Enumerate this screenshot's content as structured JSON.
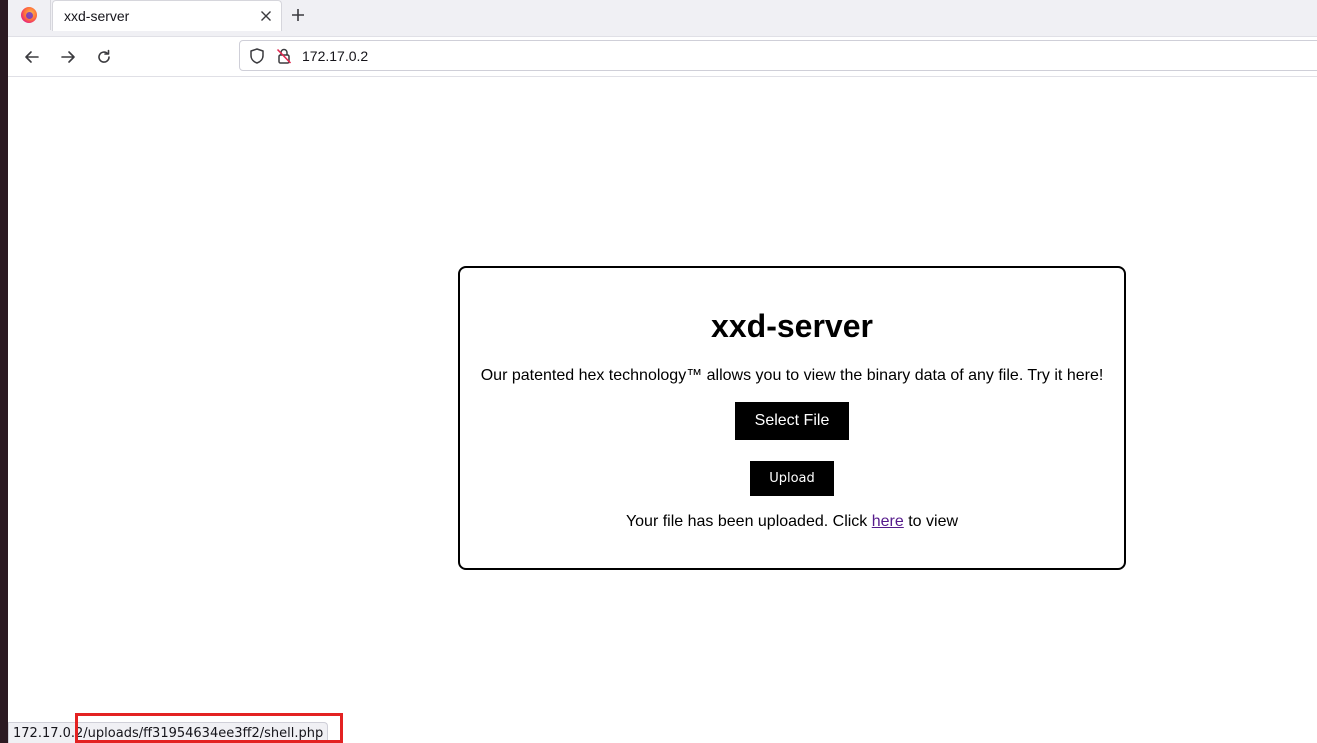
{
  "browser": {
    "tab": {
      "title": "xxd-server"
    },
    "url": "172.17.0.2",
    "icons": {
      "app": "firefox-icon",
      "close": "close-icon",
      "new_tab": "plus-icon",
      "back": "arrow-left-icon",
      "forward": "arrow-right-icon",
      "reload": "reload-icon",
      "tracking": "shield-icon",
      "insecure": "insecure-lock-icon"
    }
  },
  "page": {
    "title": "xxd-server",
    "description": "Our patented hex technology™ allows you to view the binary data of any file. Try it here!",
    "select_button": "Select File",
    "upload_button": "Upload",
    "status_prefix": "Your file has been uploaded. Click ",
    "status_link": "here",
    "status_suffix": " to view"
  },
  "statusbar": {
    "link_url": "172.17.0.2/uploads/ff31954634ee3ff2/shell.php"
  },
  "colors": {
    "highlight": "#e32222",
    "visited_link": "#551a8b",
    "button_bg": "#000000"
  }
}
